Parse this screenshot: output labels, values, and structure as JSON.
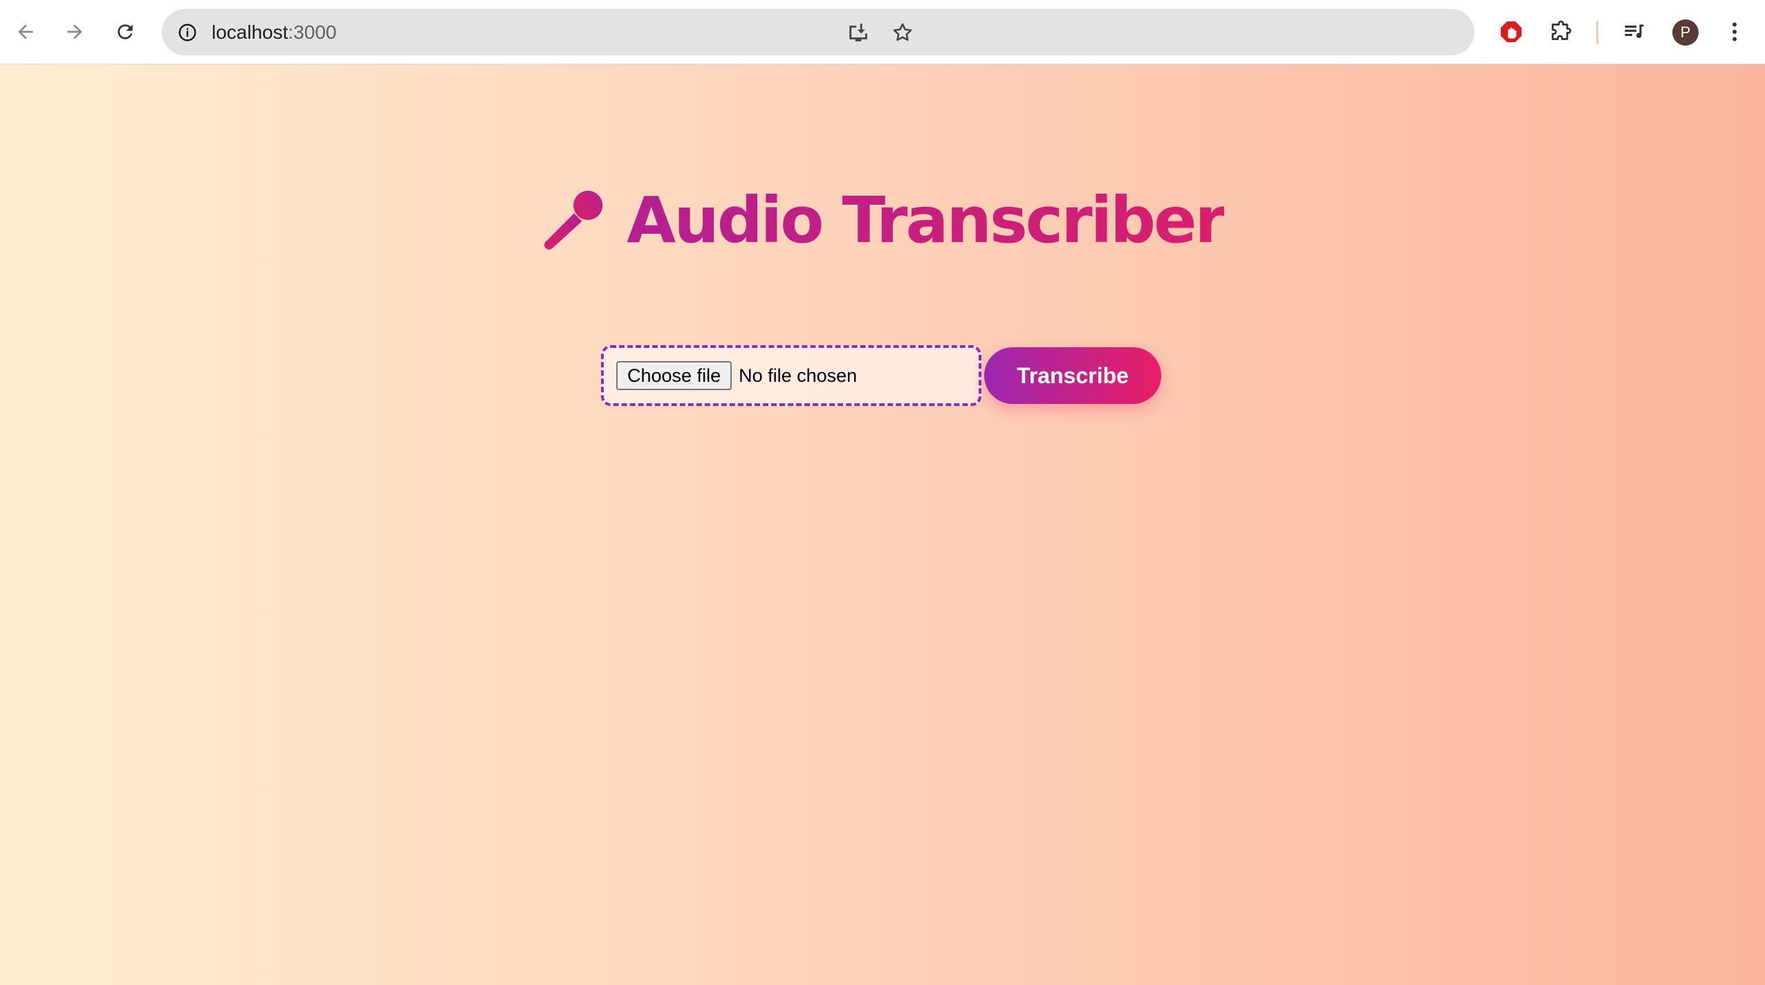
{
  "browser": {
    "url_host": "localhost",
    "url_port": ":3000",
    "profile_initial": "P"
  },
  "page": {
    "title": "Audio Transcriber",
    "file_input": {
      "choose_label": "Choose file",
      "status": "No file chosen"
    },
    "transcribe_label": "Transcribe"
  },
  "colors": {
    "background_gradient": [
      "#ffecd2",
      "#fcb69f"
    ],
    "title_color": "#c21e7d",
    "button_gradient": [
      "#9c27b0",
      "#e91e63"
    ],
    "file_box_border": "#8e2bc0"
  },
  "icons": {
    "title_icon": "microphone-icon",
    "omnibox_icons": [
      "site-info-icon",
      "install-app-icon",
      "bookmark-star-icon"
    ],
    "toolbar_icons": [
      "back-arrow-icon",
      "forward-arrow-icon",
      "reload-icon",
      "adblock-extension-icon",
      "extensions-puzzle-icon",
      "media-controls-icon",
      "kebab-menu-icon"
    ]
  }
}
